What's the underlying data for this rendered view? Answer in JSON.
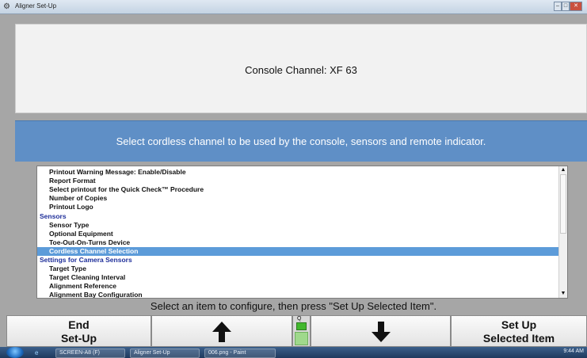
{
  "window": {
    "title": "Aligner Set-Up"
  },
  "info_panel": {
    "text": "Console Channel: XF 63"
  },
  "instruction": {
    "text": "Select cordless channel to be used by the console, sensors and remote indicator."
  },
  "list": {
    "items": [
      {
        "label": "Printout Warning Message:  Enable/Disable",
        "kind": "item",
        "selected": false
      },
      {
        "label": "Report Format",
        "kind": "item",
        "selected": false
      },
      {
        "label": "Select printout for the Quick Check™ Procedure",
        "kind": "item",
        "selected": false
      },
      {
        "label": "Number of Copies",
        "kind": "item",
        "selected": false
      },
      {
        "label": "Printout Logo",
        "kind": "item",
        "selected": false
      },
      {
        "label": "Sensors",
        "kind": "category",
        "selected": false
      },
      {
        "label": "Sensor Type",
        "kind": "item",
        "selected": false
      },
      {
        "label": "Optional Equipment",
        "kind": "item",
        "selected": false
      },
      {
        "label": "Toe-Out-On-Turns Device",
        "kind": "item",
        "selected": false
      },
      {
        "label": "Cordless Channel Selection",
        "kind": "item",
        "selected": true
      },
      {
        "label": "Settings for Camera Sensors",
        "kind": "category",
        "selected": false
      },
      {
        "label": "Target Type",
        "kind": "item",
        "selected": false
      },
      {
        "label": "Target Cleaning Interval",
        "kind": "item",
        "selected": false
      },
      {
        "label": "Alignment Reference",
        "kind": "item",
        "selected": false
      },
      {
        "label": "Alignment Bay Configuration",
        "kind": "item",
        "selected": false
      }
    ]
  },
  "status": {
    "text": "Select an item to configure, then press \"Set Up Selected Item\"."
  },
  "fkeys": {
    "end_line1": "End",
    "end_line2": "Set-Up",
    "up_icon": "up-arrow-icon",
    "down_icon": "down-arrow-icon",
    "setup_line1": "Set Up",
    "setup_line2": "Selected Item",
    "gauge_label": "Q"
  },
  "taskbar": {
    "items": [
      {
        "label": "SCREEN-A8 (F)"
      },
      {
        "label": "Aligner Set-Up"
      },
      {
        "label": "006.png - Paint"
      }
    ],
    "clock": "9:44 AM"
  },
  "colors": {
    "banner": "#5f8fc6",
    "selection": "#5c9bd9",
    "category_text": "#1f2f9a",
    "status_led": "#42b82e"
  }
}
